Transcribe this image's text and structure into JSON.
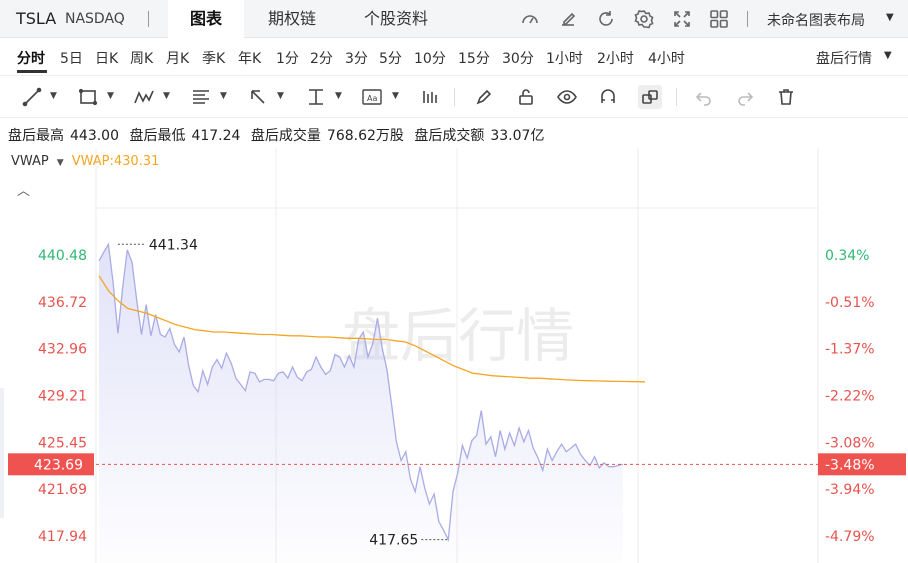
{
  "header": {
    "ticker": "TSLA",
    "exchange": "NASDAQ",
    "tabs": [
      {
        "label": "图表",
        "active": true
      },
      {
        "label": "期权链",
        "active": false
      },
      {
        "label": "个股资料",
        "active": false
      }
    ],
    "layout_label": "未命名图表布局"
  },
  "periods": {
    "items": [
      "分时",
      "5日",
      "日K",
      "周K",
      "月K",
      "季K",
      "年K",
      "1分",
      "2分",
      "3分",
      "5分",
      "10分",
      "15分",
      "30分",
      "1小时",
      "2小时",
      "4小时"
    ],
    "active": "分时",
    "session_label": "盘后行情"
  },
  "toolbar": {
    "icons": [
      "trend-line-icon",
      "rectangle-icon",
      "pattern-icon",
      "fib-icon",
      "arrow-icon",
      "measure-icon",
      "text-icon",
      "indicator-icon",
      "pencil-icon",
      "lock-icon",
      "eye-icon",
      "magnet-icon",
      "link-icon",
      "undo-icon",
      "redo-icon",
      "trash-icon"
    ]
  },
  "stats": {
    "high_label": "盘后最高",
    "high": "443.00",
    "low_label": "盘后最低",
    "low": "417.24",
    "volume_label": "盘后成交量",
    "volume": "768.62万股",
    "turnover_label": "盘后成交额",
    "turnover": "33.07亿"
  },
  "indicator": {
    "name": "VWAP",
    "value_text": "VWAP:430.31"
  },
  "colors": {
    "up": "#2fb873",
    "down": "#e8534f",
    "price_line": "#a9abe6",
    "vwap_line": "#f5a524",
    "current_bg": "#ef5350"
  },
  "chart_data": {
    "type": "line",
    "watermark": "盘后行情",
    "y_ticks": [
      "440.48",
      "436.72",
      "432.96",
      "429.21",
      "425.45",
      "421.69",
      "417.94"
    ],
    "pct_ticks": [
      "0.34%",
      "-0.51%",
      "-1.37%",
      "-2.22%",
      "-3.08%",
      "-3.94%",
      "-4.79%"
    ],
    "ylim": [
      417.94,
      440.48
    ],
    "current_price": "423.69",
    "current_pct": "-3.48%",
    "high_annotation": "441.34",
    "low_annotation": "417.65",
    "high_price": 441.34,
    "low_price": 417.65,
    "high_index": 4,
    "low_index": 74,
    "price": [
      440.0,
      440.7,
      441.34,
      438.2,
      434.2,
      437.8,
      440.9,
      439.9,
      436.8,
      434.1,
      436.5,
      434.0,
      435.7,
      434.1,
      433.9,
      434.6,
      433.3,
      432.7,
      433.9,
      431.6,
      430.0,
      429.5,
      431.2,
      430.1,
      431.5,
      432.1,
      431.4,
      432.6,
      431.8,
      430.6,
      430.1,
      429.6,
      431.1,
      431.0,
      430.3,
      430.5,
      430.5,
      430.4,
      431.0,
      431.1,
      430.6,
      431.5,
      430.7,
      430.4,
      431.1,
      431.3,
      432.3,
      431.5,
      430.9,
      431.2,
      432.5,
      432.3,
      431.5,
      432.4,
      431.5,
      433.7,
      434.3,
      432.3,
      433.4,
      435.4,
      433.0,
      431.3,
      428.5,
      425.5,
      424.0,
      424.7,
      422.5,
      421.5,
      423.5,
      421.8,
      420.5,
      421.3,
      419.1,
      418.4,
      417.65,
      421.5,
      423.0,
      425.2,
      424.2,
      425.6,
      426.0,
      428.0,
      425.3,
      425.9,
      424.3,
      426.4,
      424.9,
      426.2,
      425.2,
      426.6,
      425.5,
      426.4,
      425.0,
      424.2,
      423.2,
      424.9,
      424.0,
      424.7,
      425.3,
      424.7,
      425.0,
      425.3,
      424.5,
      424.0,
      423.6,
      424.3,
      423.4,
      423.8,
      423.5,
      423.5,
      423.6,
      423.69
    ],
    "vwap": [
      438.8,
      437.6,
      436.8,
      436.2,
      436.0,
      435.8,
      435.5,
      435.2,
      434.9,
      434.7,
      434.5,
      434.4,
      434.3,
      434.3,
      434.25,
      434.2,
      434.15,
      434.1,
      434.1,
      434.05,
      434.0,
      434.0,
      433.95,
      433.9,
      433.9,
      433.85,
      433.8,
      433.8,
      433.75,
      433.7,
      433.7,
      433.6,
      433.5,
      433.2,
      432.8,
      432.4,
      432.0,
      431.6,
      431.3,
      431.0,
      430.9,
      430.8,
      430.75,
      430.7,
      430.65,
      430.6,
      430.6,
      430.55,
      430.5,
      430.45,
      430.42,
      430.4,
      430.38,
      430.36,
      430.34,
      430.33,
      430.32,
      430.31
    ]
  }
}
